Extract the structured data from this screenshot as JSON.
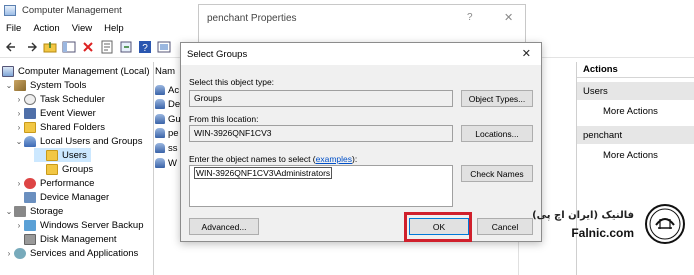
{
  "window": {
    "title": "Computer Management",
    "menu": [
      "File",
      "Action",
      "View",
      "Help"
    ]
  },
  "tree": {
    "items": [
      {
        "label": "Computer Management (Local)",
        "icon": "computer-icon"
      },
      {
        "label": "System Tools",
        "icon": "tools-icon"
      },
      {
        "label": "Task Scheduler",
        "icon": "clock-icon"
      },
      {
        "label": "Event Viewer",
        "icon": "event-viewer-icon"
      },
      {
        "label": "Shared Folders",
        "icon": "folder-icon"
      },
      {
        "label": "Local Users and Groups",
        "icon": "users-icon"
      },
      {
        "label": "Users",
        "icon": "folder-icon"
      },
      {
        "label": "Groups",
        "icon": "folder-icon"
      },
      {
        "label": "Performance",
        "icon": "performance-icon"
      },
      {
        "label": "Device Manager",
        "icon": "device-manager-icon"
      },
      {
        "label": "Storage",
        "icon": "storage-icon"
      },
      {
        "label": "Windows Server Backup",
        "icon": "backup-icon"
      },
      {
        "label": "Disk Management",
        "icon": "disk-icon"
      },
      {
        "label": "Services and Applications",
        "icon": "services-icon"
      }
    ]
  },
  "middle": {
    "header": "Nam",
    "rows": [
      "Ac",
      "De",
      "Gu",
      "pe",
      "ss",
      "W"
    ]
  },
  "actions": {
    "title": "Actions",
    "sections": [
      {
        "name": "Users",
        "item": "More Actions"
      },
      {
        "name": "penchant",
        "item": "More Actions"
      }
    ]
  },
  "properties_dialog": {
    "title": "penchant Properties",
    "help": "?",
    "close": "✕"
  },
  "select_groups": {
    "title": "Select Groups",
    "close": "✕",
    "object_type_label": "Select this object type:",
    "object_type_value": "Groups",
    "object_types_button": "Object Types...",
    "location_label": "From this location:",
    "location_value": "WIN-3926QNF1CV3",
    "locations_button": "Locations...",
    "names_label_prefix": "Enter the object names to select (",
    "names_label_link": "examples",
    "names_label_suffix": "):",
    "names_value": "WIN-3926QNF1CV3\\Administrators",
    "check_names_button": "Check Names",
    "advanced_button": "Advanced...",
    "ok_button": "OK",
    "cancel_button": "Cancel"
  },
  "watermark": {
    "text_fa": "فالنیک (ایران اچ پی)",
    "text_en": "Falnic.com",
    "emblem_text": "iranhp"
  },
  "colors": {
    "highlight": "#d0202c",
    "selection": "#cce8ff",
    "link": "#0050c8"
  }
}
